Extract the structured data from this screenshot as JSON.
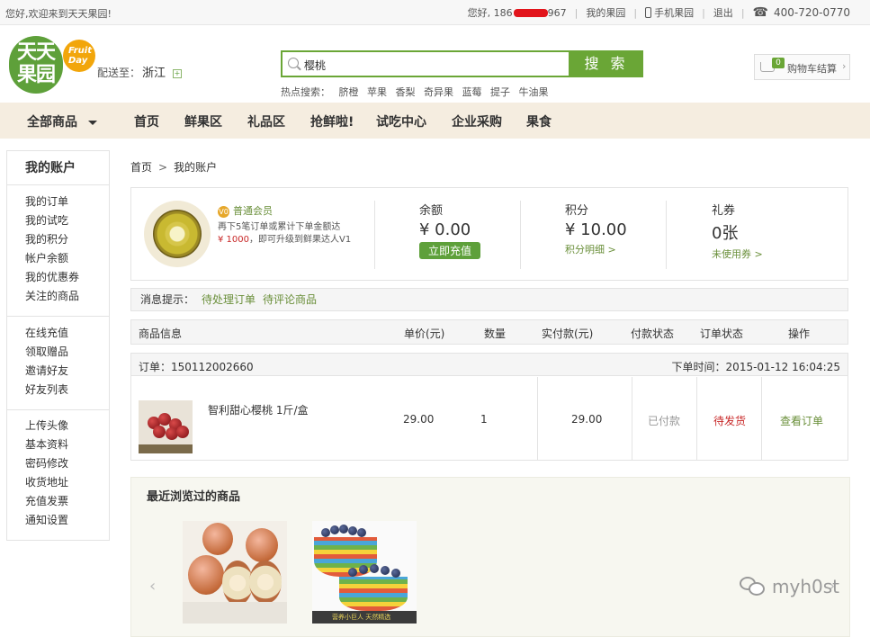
{
  "topbar": {
    "welcome": "您好,欢迎来到天天果园!",
    "greeting": "您好, 186",
    "phone_tail": "967",
    "my_orchard": "我的果园",
    "mobile": "手机果园",
    "logout": "退出",
    "hotline": "400-720-0770"
  },
  "header": {
    "logo_text": "天天果园",
    "badge_text": "Fruit Day",
    "ship_label": "配送至：",
    "province": "浙江",
    "search_value": "樱桃",
    "search_button": "搜 索",
    "hot_label": "热点搜索：",
    "hot_keywords": [
      "脐橙",
      "苹果",
      "香梨",
      "奇异果",
      "蓝莓",
      "提子",
      "牛油果"
    ],
    "cart_count": "0",
    "cart_label": "购物车结算",
    "cart_arrow": "›"
  },
  "nav": {
    "all": "全部商品",
    "items": [
      "首页",
      "鲜果区",
      "礼品区",
      "抢鲜啦!",
      "试吃中心",
      "企业采购",
      "果食"
    ]
  },
  "sidebar": {
    "title": "我的账户",
    "group1": [
      "我的订单",
      "我的试吃",
      "我的积分",
      "帐户余额",
      "我的优惠券",
      "关注的商品"
    ],
    "group2": [
      "在线充值",
      "领取赠品",
      "邀请好友",
      "好友列表"
    ],
    "group3": [
      "上传头像",
      "基本资料",
      "密码修改",
      "收货地址",
      "充值发票",
      "通知设置"
    ]
  },
  "breadcrumb": {
    "home": "首页",
    "sep": ">",
    "current": "我的账户"
  },
  "account": {
    "level_icon": "V0",
    "level": "普通会员",
    "upgrade_line1": "再下5笔订单或累计下单金额达",
    "upgrade_amount": "¥ 1000",
    "upgrade_line2": "，即可升级到鲜果达人V1",
    "balance_label": "余额",
    "balance_value": "¥ 0.00",
    "recharge_button": "立即充值",
    "points_label": "积分",
    "points_value": "¥ 10.00",
    "points_link": "积分明细 >",
    "coupon_label": "礼券",
    "coupon_value": "0张",
    "coupon_link": "未使用券 >"
  },
  "notice": {
    "label": "消息提示：",
    "link1": "待处理订单",
    "link2": "待评论商品"
  },
  "table": {
    "headers": [
      "商品信息",
      "单价(元)",
      "数量",
      "实付款(元)",
      "付款状态",
      "订单状态",
      "操作"
    ],
    "order": {
      "number_label": "订单：",
      "number": "150112002660",
      "time_label": "下单时间：",
      "time": "2015-01-12 16:04:25",
      "product": "智利甜心樱桃 1斤/盒",
      "price": "29.00",
      "qty": "1",
      "paid": "29.00",
      "pay_status": "已付款",
      "order_status": "待发货",
      "action": "查看订单"
    }
  },
  "recent": {
    "title": "最近浏览过的商品",
    "prev": "‹",
    "next": "›",
    "caption": "营养小巨人 天然精选"
  },
  "watermark": "myh0st",
  "colors": {
    "brand_green": "#6aa636",
    "nav_bg": "#f5ede0",
    "link_green": "#6a8f3a",
    "red": "#c82828"
  }
}
